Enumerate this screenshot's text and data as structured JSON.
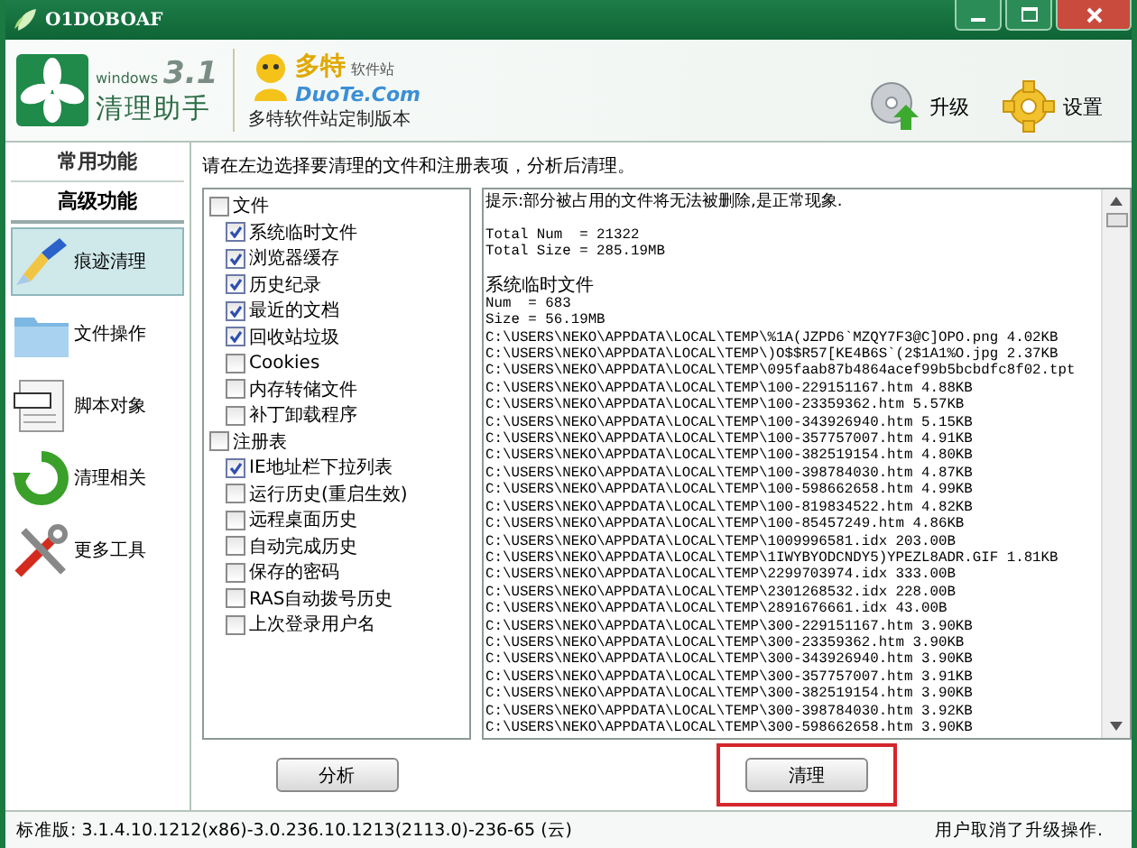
{
  "window": {
    "title": "O1DOBOAF"
  },
  "header": {
    "product_edition": "windows",
    "product_version": "3.1",
    "product_name": "清理助手",
    "partner_name": "多特",
    "partner_suffix": "软件站",
    "partner_site": "DuoTe.Com",
    "partner_caption": "多特软件站定制版本",
    "tools": [
      {
        "label": "升级",
        "kind": "upgrade"
      },
      {
        "label": "设置",
        "kind": "settings"
      }
    ]
  },
  "sidebar": {
    "tabs": [
      {
        "label": "常用功能",
        "selected": false
      },
      {
        "label": "高级功能",
        "selected": true
      }
    ],
    "items": [
      {
        "label": "痕迹清理",
        "kind": "broom",
        "selected": true
      },
      {
        "label": "文件操作",
        "kind": "folder",
        "selected": false
      },
      {
        "label": "脚本对象",
        "kind": "script",
        "selected": false
      },
      {
        "label": "清理相关",
        "kind": "refresh",
        "selected": false
      },
      {
        "label": "更多工具",
        "kind": "tools",
        "selected": false
      }
    ]
  },
  "instruction": "请在左边选择要清理的文件和注册表项，分析后清理。",
  "tree": [
    {
      "label": "文件",
      "checked": false,
      "children": [
        {
          "label": "系统临时文件",
          "checked": true
        },
        {
          "label": "浏览器缓存",
          "checked": true
        },
        {
          "label": "历史纪录",
          "checked": true
        },
        {
          "label": "最近的文档",
          "checked": true
        },
        {
          "label": "回收站垃圾",
          "checked": true
        },
        {
          "label": "Cookies",
          "checked": false
        },
        {
          "label": "内存转储文件",
          "checked": false
        },
        {
          "label": "补丁卸载程序",
          "checked": false
        }
      ]
    },
    {
      "label": "注册表",
      "checked": false,
      "children": [
        {
          "label": "IE地址栏下拉列表",
          "checked": true
        },
        {
          "label": "运行历史(重启生效)",
          "checked": false
        },
        {
          "label": "远程桌面历史",
          "checked": false
        },
        {
          "label": "自动完成历史",
          "checked": false
        },
        {
          "label": "保存的密码",
          "checked": false
        },
        {
          "label": "RAS自动拨号历史",
          "checked": false
        },
        {
          "label": "上次登录用户名",
          "checked": false
        }
      ]
    }
  ],
  "log": [
    {
      "lines": [
        {
          "text": "提示:部分被占用的文件将无法被删除,是正常现象.",
          "kind": "note"
        }
      ]
    },
    {
      "lines": [
        {
          "text": "Total Num  = 21322",
          "kind": "line"
        },
        {
          "text": "Total Size = 285.19MB",
          "kind": "line"
        }
      ]
    },
    {
      "lines": [
        {
          "text": "系统临时文件",
          "kind": "heading"
        },
        {
          "text": "Num  = 683",
          "kind": "line"
        },
        {
          "text": "Size = 56.19MB",
          "kind": "line"
        },
        {
          "text": "C:\\USERS\\NEKO\\APPDATA\\LOCAL\\TEMP\\%1A(JZPD6`MZQY7F3@C]OPO.png 4.02KB",
          "kind": "line"
        },
        {
          "text": "C:\\USERS\\NEKO\\APPDATA\\LOCAL\\TEMP\\)O$$R57[KE4B6S`(2$1A1%O.jpg 2.37KB",
          "kind": "line"
        },
        {
          "text": "C:\\USERS\\NEKO\\APPDATA\\LOCAL\\TEMP\\095faab87b4864acef99b5bcbdfc8f02.tpt",
          "kind": "line"
        },
        {
          "text": "C:\\USERS\\NEKO\\APPDATA\\LOCAL\\TEMP\\100-229151167.htm 4.88KB",
          "kind": "line"
        },
        {
          "text": "C:\\USERS\\NEKO\\APPDATA\\LOCAL\\TEMP\\100-23359362.htm 5.57KB",
          "kind": "line"
        },
        {
          "text": "C:\\USERS\\NEKO\\APPDATA\\LOCAL\\TEMP\\100-343926940.htm 5.15KB",
          "kind": "line"
        },
        {
          "text": "C:\\USERS\\NEKO\\APPDATA\\LOCAL\\TEMP\\100-357757007.htm 4.91KB",
          "kind": "line"
        },
        {
          "text": "C:\\USERS\\NEKO\\APPDATA\\LOCAL\\TEMP\\100-382519154.htm 4.80KB",
          "kind": "line"
        },
        {
          "text": "C:\\USERS\\NEKO\\APPDATA\\LOCAL\\TEMP\\100-398784030.htm 4.87KB",
          "kind": "line"
        },
        {
          "text": "C:\\USERS\\NEKO\\APPDATA\\LOCAL\\TEMP\\100-598662658.htm 4.99KB",
          "kind": "line"
        },
        {
          "text": "C:\\USERS\\NEKO\\APPDATA\\LOCAL\\TEMP\\100-819834522.htm 4.82KB",
          "kind": "line"
        },
        {
          "text": "C:\\USERS\\NEKO\\APPDATA\\LOCAL\\TEMP\\100-85457249.htm 4.86KB",
          "kind": "line"
        },
        {
          "text": "C:\\USERS\\NEKO\\APPDATA\\LOCAL\\TEMP\\1009996581.idx 203.00B",
          "kind": "line"
        },
        {
          "text": "C:\\USERS\\NEKO\\APPDATA\\LOCAL\\TEMP\\1IWYBYODCNDY5)YPEZL8ADR.GIF 1.81KB",
          "kind": "line"
        },
        {
          "text": "C:\\USERS\\NEKO\\APPDATA\\LOCAL\\TEMP\\2299703974.idx 333.00B",
          "kind": "line"
        },
        {
          "text": "C:\\USERS\\NEKO\\APPDATA\\LOCAL\\TEMP\\2301268532.idx 228.00B",
          "kind": "line"
        },
        {
          "text": "C:\\USERS\\NEKO\\APPDATA\\LOCAL\\TEMP\\2891676661.idx 43.00B",
          "kind": "line"
        },
        {
          "text": "C:\\USERS\\NEKO\\APPDATA\\LOCAL\\TEMP\\300-229151167.htm 3.90KB",
          "kind": "line"
        },
        {
          "text": "C:\\USERS\\NEKO\\APPDATA\\LOCAL\\TEMP\\300-23359362.htm 3.90KB",
          "kind": "line"
        },
        {
          "text": "C:\\USERS\\NEKO\\APPDATA\\LOCAL\\TEMP\\300-343926940.htm 3.90KB",
          "kind": "line"
        },
        {
          "text": "C:\\USERS\\NEKO\\APPDATA\\LOCAL\\TEMP\\300-357757007.htm 3.91KB",
          "kind": "line"
        },
        {
          "text": "C:\\USERS\\NEKO\\APPDATA\\LOCAL\\TEMP\\300-382519154.htm 3.90KB",
          "kind": "line"
        },
        {
          "text": "C:\\USERS\\NEKO\\APPDATA\\LOCAL\\TEMP\\300-398784030.htm 3.92KB",
          "kind": "line"
        },
        {
          "text": "C:\\USERS\\NEKO\\APPDATA\\LOCAL\\TEMP\\300-598662658.htm 3.90KB",
          "kind": "line"
        }
      ]
    }
  ],
  "buttons": [
    {
      "label": "分析",
      "highlighted": false
    },
    {
      "label": "清理",
      "highlighted": true
    }
  ],
  "status_bar": {
    "version": "标准版: 3.1.4.10.1212(x86)-3.0.236.10.1213(2113.0)-236-65 (云)",
    "message": "用户取消了升级操作."
  }
}
